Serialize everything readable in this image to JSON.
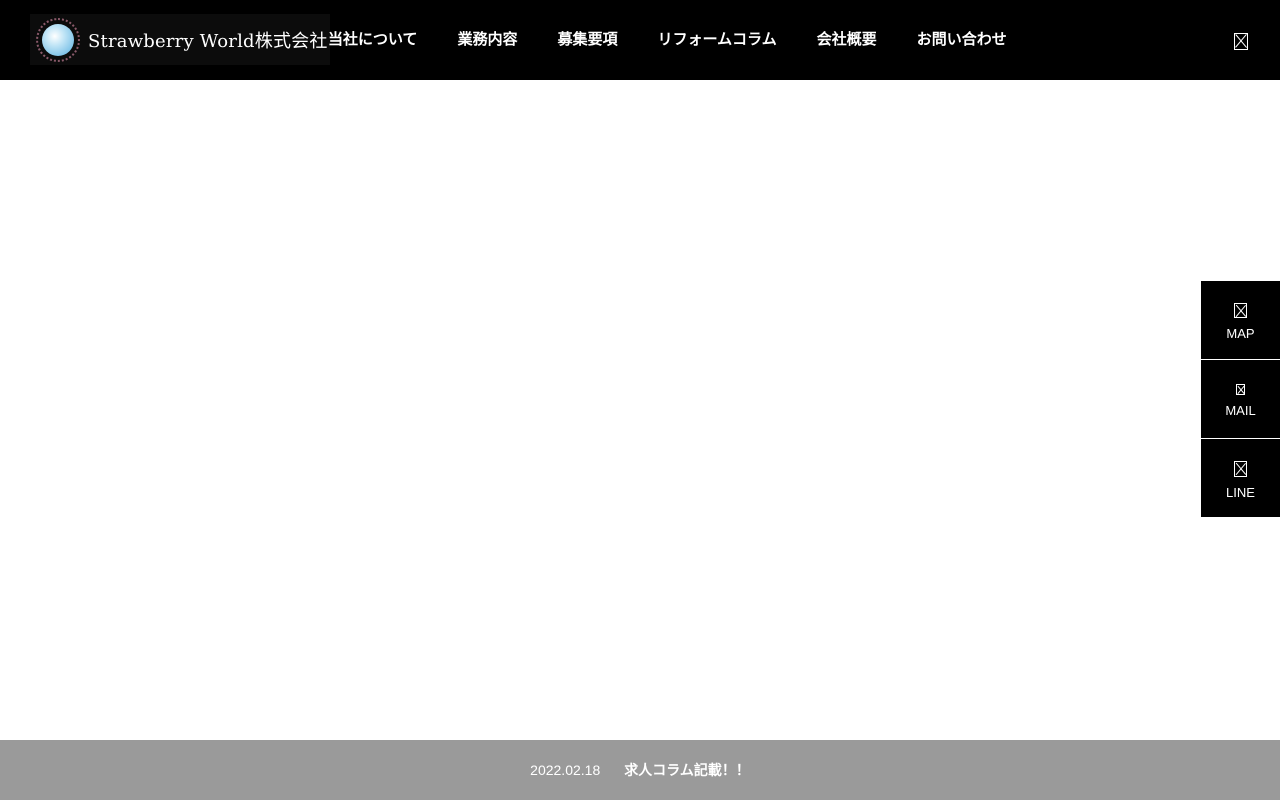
{
  "header": {
    "logo_text": "Strawberry World株式会社",
    "nav": [
      {
        "label": "当社について"
      },
      {
        "label": "業務内容"
      },
      {
        "label": "募集要項"
      },
      {
        "label": "リフォームコラム"
      },
      {
        "label": "会社概要"
      },
      {
        "label": "お問い合わせ"
      }
    ],
    "menu_icon": "box-icon"
  },
  "side_buttons": [
    {
      "label": "MAP",
      "icon": "map-icon"
    },
    {
      "label": "MAIL",
      "icon": "mail-icon"
    },
    {
      "label": "LINE",
      "icon": "line-icon"
    }
  ],
  "news": {
    "date": "2022.02.18",
    "title": "求人コラム記載！！"
  },
  "colors": {
    "header_bg": "#000000",
    "news_bar_bg": "#9a9a9a",
    "text": "#ffffff"
  }
}
